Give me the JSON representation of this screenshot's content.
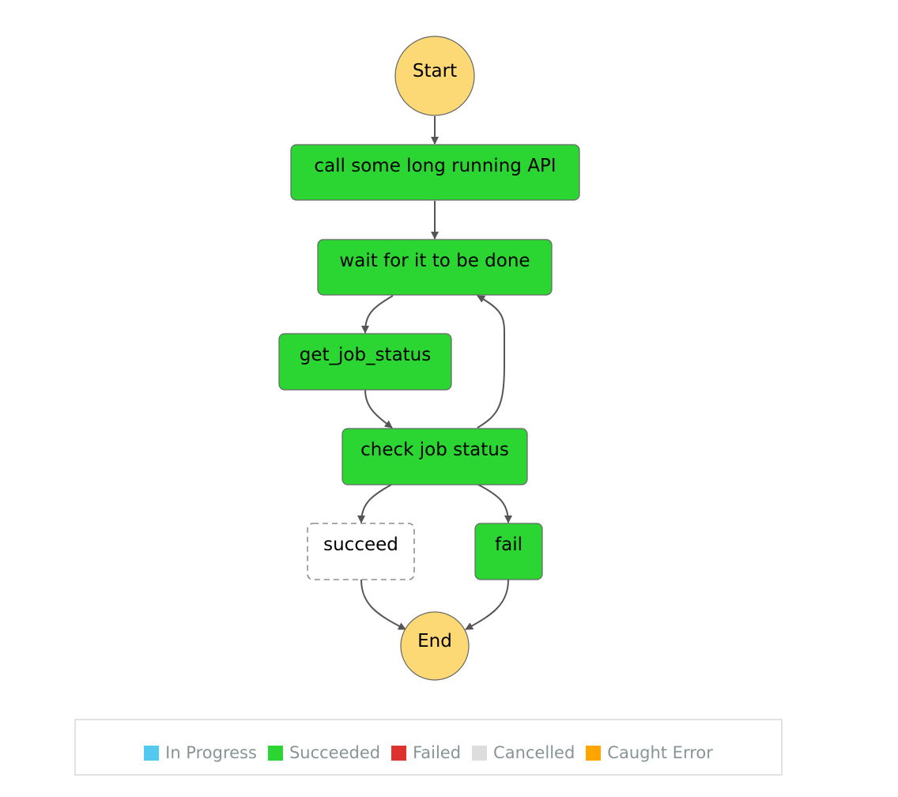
{
  "diagram": {
    "nodes": [
      {
        "id": "start",
        "label": "Start",
        "shape": "circle",
        "status": "terminal"
      },
      {
        "id": "call",
        "label": "call some long running API",
        "shape": "rect",
        "status": "Succeeded"
      },
      {
        "id": "wait",
        "label": "wait for it to be done",
        "shape": "rect",
        "status": "Succeeded"
      },
      {
        "id": "get",
        "label": "get_job_status",
        "shape": "rect",
        "status": "Succeeded"
      },
      {
        "id": "check",
        "label": "check job status",
        "shape": "rect",
        "status": "Succeeded"
      },
      {
        "id": "succeed",
        "label": "succeed",
        "shape": "rect",
        "status": "Not executed"
      },
      {
        "id": "fail",
        "label": "fail",
        "shape": "rect",
        "status": "Succeeded"
      },
      {
        "id": "end",
        "label": "End",
        "shape": "circle",
        "status": "terminal"
      }
    ],
    "edges": [
      {
        "from": "start",
        "to": "call"
      },
      {
        "from": "call",
        "to": "wait"
      },
      {
        "from": "wait",
        "to": "get"
      },
      {
        "from": "get",
        "to": "check"
      },
      {
        "from": "check",
        "to": "wait"
      },
      {
        "from": "check",
        "to": "succeed"
      },
      {
        "from": "check",
        "to": "fail"
      },
      {
        "from": "succeed",
        "to": "end"
      },
      {
        "from": "fail",
        "to": "end"
      }
    ],
    "colors": {
      "terminal": "#fdd975",
      "Succeeded": "#2cd632",
      "Not executed": "#ffffff",
      "edge": "#555555"
    }
  },
  "legend": [
    {
      "label": "In Progress",
      "color": "#53c9ed"
    },
    {
      "label": "Succeeded",
      "color": "#2cd632"
    },
    {
      "label": "Failed",
      "color": "#de322f"
    },
    {
      "label": "Cancelled",
      "color": "#dddddd"
    },
    {
      "label": "Caught Error",
      "color": "#ffa500"
    }
  ]
}
